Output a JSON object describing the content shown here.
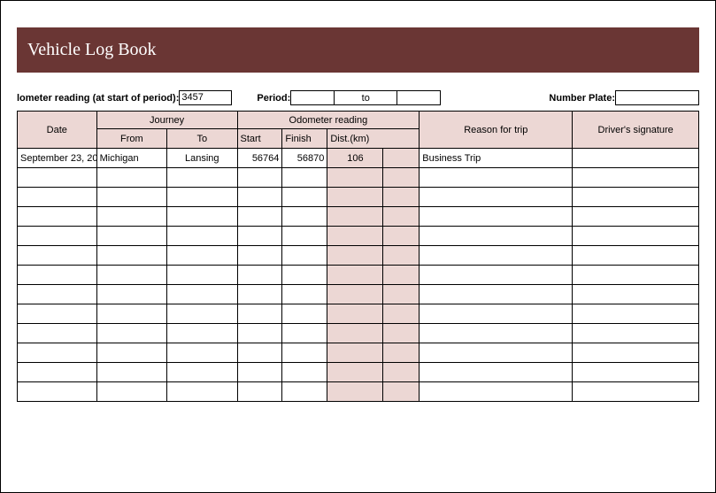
{
  "title": "Vehicle Log Book",
  "meta": {
    "odometer_label": "lometer reading (at start of period):",
    "odometer_value": "3457",
    "period_label": "Period:",
    "period_from": "",
    "period_to_word": "to",
    "period_to": "",
    "plate_label": "Number Plate:",
    "plate_value": ""
  },
  "headers": {
    "date": "Date",
    "journey": "Journey",
    "from": "From",
    "to": "To",
    "odo": "Odometer reading",
    "start": "Start",
    "finish": "Finish",
    "dist": "Dist.(km)",
    "reason": "Reason for trip",
    "sig": "Driver's signature"
  },
  "rows": [
    {
      "date": "September 23, 20",
      "from": "Michigan",
      "to": "Lansing",
      "start": "56764",
      "finish": "56870",
      "dist": "106",
      "reason": "Business Trip",
      "sig": ""
    },
    {
      "date": "",
      "from": "",
      "to": "",
      "start": "",
      "finish": "",
      "dist": "",
      "reason": "",
      "sig": ""
    },
    {
      "date": "",
      "from": "",
      "to": "",
      "start": "",
      "finish": "",
      "dist": "",
      "reason": "",
      "sig": ""
    },
    {
      "date": "",
      "from": "",
      "to": "",
      "start": "",
      "finish": "",
      "dist": "",
      "reason": "",
      "sig": ""
    },
    {
      "date": "",
      "from": "",
      "to": "",
      "start": "",
      "finish": "",
      "dist": "",
      "reason": "",
      "sig": ""
    },
    {
      "date": "",
      "from": "",
      "to": "",
      "start": "",
      "finish": "",
      "dist": "",
      "reason": "",
      "sig": ""
    },
    {
      "date": "",
      "from": "",
      "to": "",
      "start": "",
      "finish": "",
      "dist": "",
      "reason": "",
      "sig": ""
    },
    {
      "date": "",
      "from": "",
      "to": "",
      "start": "",
      "finish": "",
      "dist": "",
      "reason": "",
      "sig": ""
    },
    {
      "date": "",
      "from": "",
      "to": "",
      "start": "",
      "finish": "",
      "dist": "",
      "reason": "",
      "sig": ""
    },
    {
      "date": "",
      "from": "",
      "to": "",
      "start": "",
      "finish": "",
      "dist": "",
      "reason": "",
      "sig": ""
    },
    {
      "date": "",
      "from": "",
      "to": "",
      "start": "",
      "finish": "",
      "dist": "",
      "reason": "",
      "sig": ""
    },
    {
      "date": "",
      "from": "",
      "to": "",
      "start": "",
      "finish": "",
      "dist": "",
      "reason": "",
      "sig": ""
    },
    {
      "date": "",
      "from": "",
      "to": "",
      "start": "",
      "finish": "",
      "dist": "",
      "reason": "",
      "sig": ""
    }
  ]
}
